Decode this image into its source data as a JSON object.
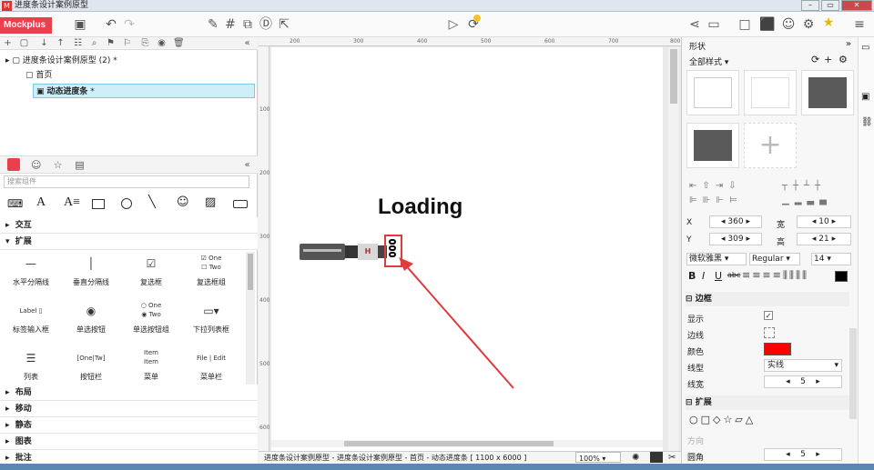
{
  "window": {
    "title": "进度条设计案例原型"
  },
  "toolbar": {
    "brand": "Mockplus"
  },
  "left_panel": {
    "tree": [
      {
        "label": "进度条设计案例原型 (2)",
        "marker": "*"
      },
      {
        "label": "首页"
      },
      {
        "label": "动态进度条",
        "marker": "*"
      }
    ],
    "search_placeholder": "搜索组件",
    "categories": [
      "交互",
      "扩展",
      "布局",
      "移动",
      "静态",
      "图表",
      "批注"
    ],
    "components": [
      {
        "label": "水平分隔线"
      },
      {
        "label": "垂直分隔线"
      },
      {
        "label": "复选框"
      },
      {
        "label": "复选框组",
        "items": [
          "One",
          "Two"
        ]
      },
      {
        "label": "标签输入框",
        "sample": "Label"
      },
      {
        "label": "单选按钮"
      },
      {
        "label": "单选按钮组",
        "items": [
          "One",
          "Two"
        ]
      },
      {
        "label": "下拉列表框"
      },
      {
        "label": "列表"
      },
      {
        "label": "按钮栏",
        "items": [
          "One",
          "Tw"
        ]
      },
      {
        "label": "菜单",
        "items": [
          "Item",
          "Item"
        ]
      },
      {
        "label": "菜单栏",
        "items": [
          "File",
          "Edit"
        ]
      }
    ]
  },
  "canvas": {
    "ruler_h": [
      "200",
      "300",
      "400",
      "500",
      "600",
      "700",
      "800"
    ],
    "ruler_v": [
      "100",
      "200",
      "300",
      "400",
      "500",
      "600"
    ],
    "loading_text": "Loading",
    "hilt_letter": "H"
  },
  "status": {
    "path": "进度条设计案例原型 - 进度条设计案例原型 - 首页 - 动态进度条 [ 1100 x 6000 ]",
    "zoom": "100%"
  },
  "right_panel": {
    "title": "形状",
    "style_dropdown": "全部样式",
    "x_label": "X",
    "x_value": "360",
    "y_label": "Y",
    "y_value": "309",
    "w_label": "宽",
    "w_value": "10",
    "h_label": "高",
    "h_value": "21",
    "font_family": "微软雅黑",
    "font_style": "Regular",
    "font_size": "14",
    "bold": "B",
    "italic": "I",
    "underline": "U",
    "strike": "abc",
    "border_section": "边框",
    "show_label": "显示",
    "edge_label": "边线",
    "color_label": "颜色",
    "line_type_label": "线型",
    "line_type_value": "实线",
    "line_width_label": "线宽",
    "line_width_value": "5",
    "extend_section": "扩展",
    "direction_label": "方向",
    "corner_label": "圆角",
    "corner_value": "5",
    "border_color": "#ff0000"
  },
  "colors": {
    "accent": "#e8414d",
    "selection": "#ff0000",
    "arrow": "#e03a3a"
  }
}
